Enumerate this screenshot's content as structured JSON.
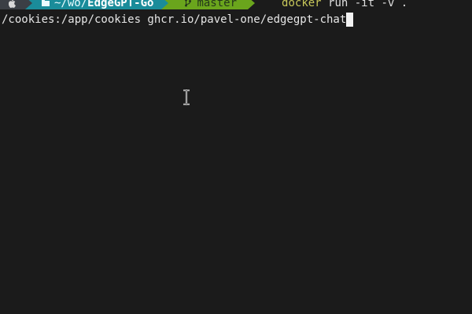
{
  "prompt": {
    "os_icon": "apple-icon",
    "path_prefix": "~/wo/",
    "path_dir": "EdgeGPT-Go",
    "branch_icon": "branch-icon",
    "branch": "master",
    "command_start": "docker",
    "command_rest": " run -it -v ."
  },
  "continuation": {
    "text": "/cookies:/app/cookies ghcr.io/pavel-one/edgegpt-chat"
  },
  "colors": {
    "background": "#1b1b1b",
    "path_segment": "#1a8c9a",
    "git_segment": "#6aa51c"
  }
}
